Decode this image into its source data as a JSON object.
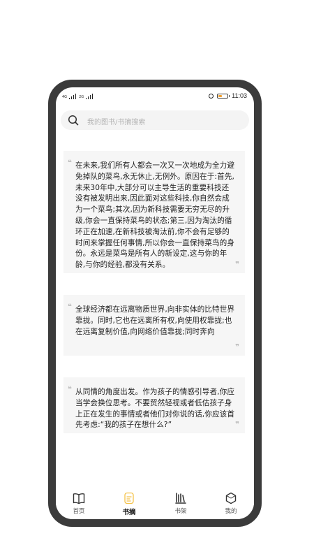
{
  "status_bar": {
    "network_label_1": "4G",
    "network_label_2": "2G",
    "time": "11:03",
    "battery_color": "#f0a030",
    "battery_level": 0.4
  },
  "search": {
    "placeholder": "我的图书/书摘搜索"
  },
  "quotes": [
    {
      "text": "在未来,我们所有人都会一次又一次地成为全力避免掉队的菜鸟,永无休止,无例外。原因在于:首先,未来30年中,大部分可以主导生活的重要科技还没有被发明出来,因此面对这些科技,你自然会成为一个菜鸟;其次,因为新科技需要无穷无尽的升级,你会一直保持菜鸟的状态;第三,因为淘汰的循环正在加速,在新科技被淘汰前,你不会有足够的时间来掌握任何事情,所以你会一直保持菜鸟的身份。永远是菜鸟是所有人的新设定,这与你的年龄,与你的经验,都没有关系。"
    },
    {
      "text": "全球经济都在远离物质世界,向非实体的比特世界靠拢。同时,它也在远离所有权,向使用权靠拢;也在远离复制价值,向网络价值靠拢;同时奔向"
    },
    {
      "text": "从同情的角度出发。作为孩子的情感引导者,你应当学会换位思考。不要贸然轻视或者低估孩子身上正在发生的事情或者他们对你说的话,你应该首先考虑:“我的孩子在想什么?”"
    }
  ],
  "quote_mark_open": "❞",
  "quote_mark_close": "❞",
  "tabs": [
    {
      "label": "首页",
      "icon": "book-open-icon",
      "active": false
    },
    {
      "label": "书摘",
      "icon": "excerpt-icon",
      "active": true,
      "accent": "#f5c24a"
    },
    {
      "label": "书架",
      "icon": "bookshelf-icon",
      "active": false
    },
    {
      "label": "我的",
      "icon": "hexagon-profile-icon",
      "active": false
    }
  ]
}
